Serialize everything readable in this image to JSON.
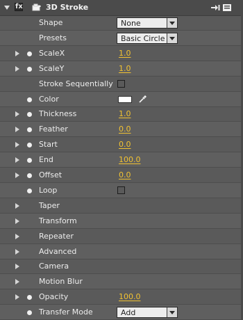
{
  "effect": {
    "title": "3D Stroke",
    "toggle": "fx",
    "icons": {
      "collapse": "triangle-down-icon",
      "plugin": "plugin-icon",
      "header_right_1": "keyframe-navigator-icon",
      "header_right_2": "effect-menu-icon"
    }
  },
  "rows": [
    {
      "id": "shape",
      "label": "Shape",
      "type": "dropdown",
      "value": "None",
      "expander": false,
      "stopwatch": false
    },
    {
      "id": "presets",
      "label": "Presets",
      "type": "dropdown",
      "value": "Basic Circle",
      "expander": false,
      "stopwatch": false
    },
    {
      "id": "scalex",
      "label": "ScaleX",
      "type": "number",
      "value": "1.0",
      "expander": true,
      "stopwatch": true
    },
    {
      "id": "scaley",
      "label": "ScaleY",
      "type": "number",
      "value": "1.0",
      "expander": true,
      "stopwatch": true
    },
    {
      "id": "stroke_seq",
      "label": "Stroke Sequentially",
      "type": "checkbox",
      "value": "",
      "expander": false,
      "stopwatch": false
    },
    {
      "id": "color",
      "label": "Color",
      "type": "color",
      "value": "#ffffff",
      "expander": false,
      "stopwatch": true
    },
    {
      "id": "thickness",
      "label": "Thickness",
      "type": "number",
      "value": "1.0",
      "expander": true,
      "stopwatch": true
    },
    {
      "id": "feather",
      "label": "Feather",
      "type": "number",
      "value": "0.0",
      "expander": true,
      "stopwatch": true
    },
    {
      "id": "start",
      "label": "Start",
      "type": "number",
      "value": "0.0",
      "expander": true,
      "stopwatch": true
    },
    {
      "id": "end",
      "label": "End",
      "type": "number",
      "value": "100.0",
      "expander": true,
      "stopwatch": true
    },
    {
      "id": "offset",
      "label": "Offset",
      "type": "number",
      "value": "0.0",
      "expander": true,
      "stopwatch": true
    },
    {
      "id": "loop",
      "label": "Loop",
      "type": "checkbox",
      "value": "",
      "expander": false,
      "stopwatch": true
    },
    {
      "id": "taper",
      "label": "Taper",
      "type": "group",
      "value": "",
      "expander": true,
      "stopwatch": false
    },
    {
      "id": "transform",
      "label": "Transform",
      "type": "group",
      "value": "",
      "expander": true,
      "stopwatch": false
    },
    {
      "id": "repeater",
      "label": "Repeater",
      "type": "group",
      "value": "",
      "expander": true,
      "stopwatch": false
    },
    {
      "id": "advanced",
      "label": "Advanced",
      "type": "group",
      "value": "",
      "expander": true,
      "stopwatch": false
    },
    {
      "id": "camera",
      "label": "Camera",
      "type": "group",
      "value": "",
      "expander": true,
      "stopwatch": false
    },
    {
      "id": "motion_blur",
      "label": "Motion Blur",
      "type": "group",
      "value": "",
      "expander": true,
      "stopwatch": false
    },
    {
      "id": "opacity",
      "label": "Opacity",
      "type": "number",
      "value": "100.0",
      "expander": true,
      "stopwatch": true
    },
    {
      "id": "transfer_mode",
      "label": "Transfer Mode",
      "type": "dropdown",
      "value": "Add",
      "expander": false,
      "stopwatch": true
    }
  ],
  "colors": {
    "value_text": "#f1c232",
    "panel_bg": "#5a5a5a",
    "header_bg": "#4b4b4b"
  }
}
